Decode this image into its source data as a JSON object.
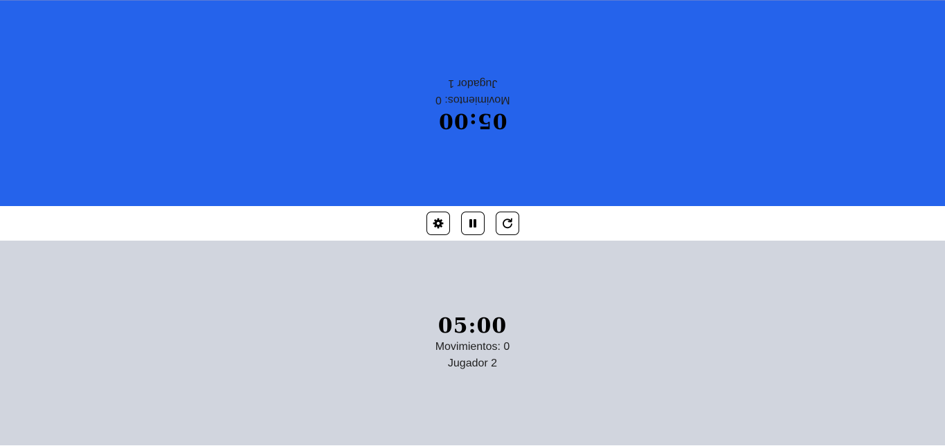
{
  "player1": {
    "time": "05:00",
    "moves_label": "Movimientos: 0",
    "name": "Jugador 1",
    "color": "#2563eb",
    "orientation": "rotated-180"
  },
  "player2": {
    "time": "05:00",
    "moves_label": "Movimientos: 0",
    "name": "Jugador 2",
    "color": "#d1d5de"
  },
  "controls": {
    "settings_icon": "gear-icon",
    "pause_icon": "pause-icon",
    "reset_icon": "reset-icon"
  }
}
